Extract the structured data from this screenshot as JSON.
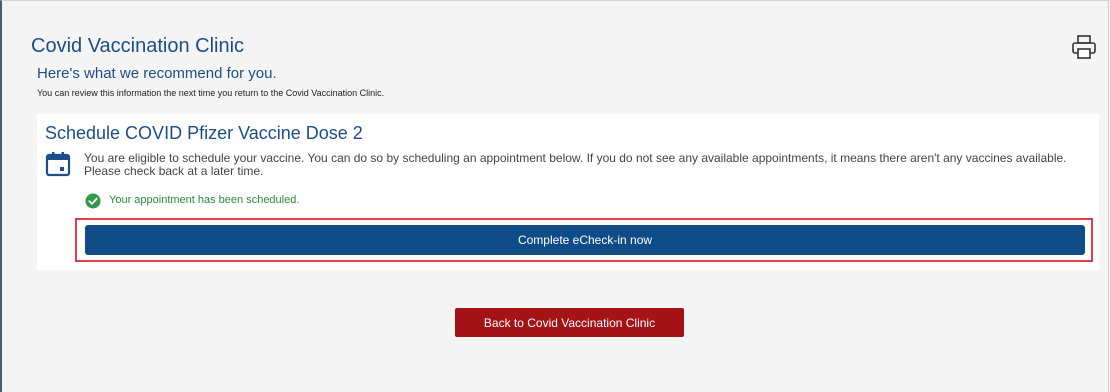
{
  "clinic": {
    "title": "Covid Vaccination Clinic",
    "recommend_heading": "Here's what we recommend for you.",
    "review_note": "You can review this information the next time you return to the Covid Vaccination Clinic."
  },
  "card": {
    "title": "Schedule COVID Pfizer Vaccine Dose 2",
    "eligible_text": "You are eligible to schedule your vaccine. You can do so by scheduling an appointment below. If you do not see any available appointments, it means there aren't any vaccines available. Please check back at a later time.",
    "scheduled_text": "Your appointment has been scheduled.",
    "echeck_button_label": "Complete eCheck-in now"
  },
  "back_button_label": "Back to Covid Vaccination Clinic",
  "icons": {
    "print": "print-icon",
    "calendar": "calendar-icon",
    "check": "check-circle-icon"
  },
  "colors": {
    "heading_blue": "#1d4e89",
    "primary_button": "#0f4c87",
    "back_button": "#a31318",
    "success_green": "#2e8b3a",
    "highlight_red": "#e0404a"
  }
}
